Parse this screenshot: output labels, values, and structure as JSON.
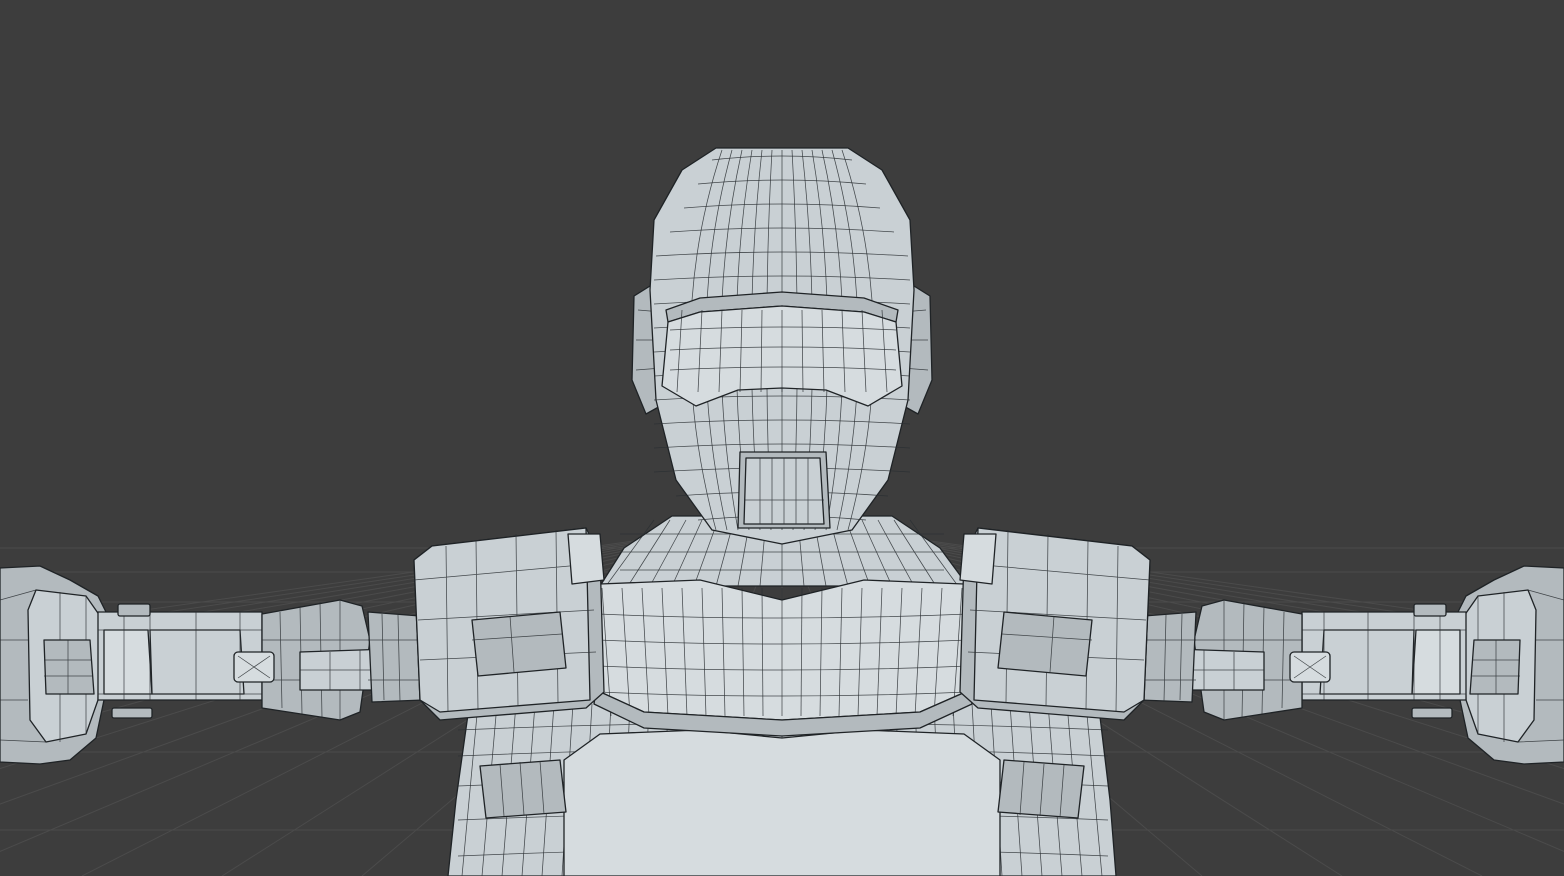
{
  "viewport": {
    "background_color": "#3d3d3d",
    "grid_color": "#4b4b4b",
    "mesh_fill_color": "#c9d0d4",
    "wire_color": "#2a2f33",
    "display_mode": "wireframe-on-shaded",
    "pose": "T-pose"
  }
}
